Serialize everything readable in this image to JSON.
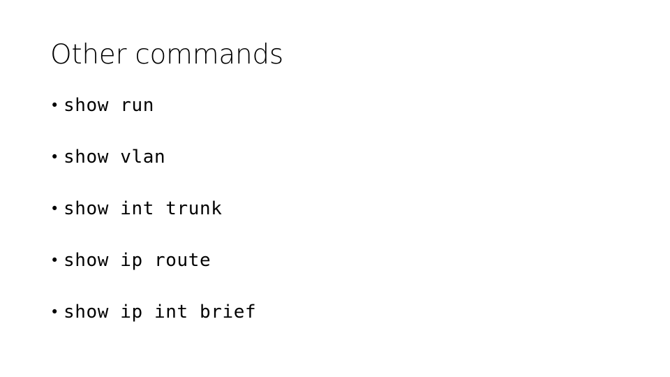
{
  "slide": {
    "background_color": "#ffffff",
    "text_color": "#000000",
    "title": "Other commands",
    "bullet_glyph": "•",
    "items": [
      {
        "text": "show run"
      },
      {
        "text": "show vlan"
      },
      {
        "text": "show int trunk"
      },
      {
        "text": "show ip route"
      },
      {
        "text": "show ip int brief"
      }
    ]
  }
}
